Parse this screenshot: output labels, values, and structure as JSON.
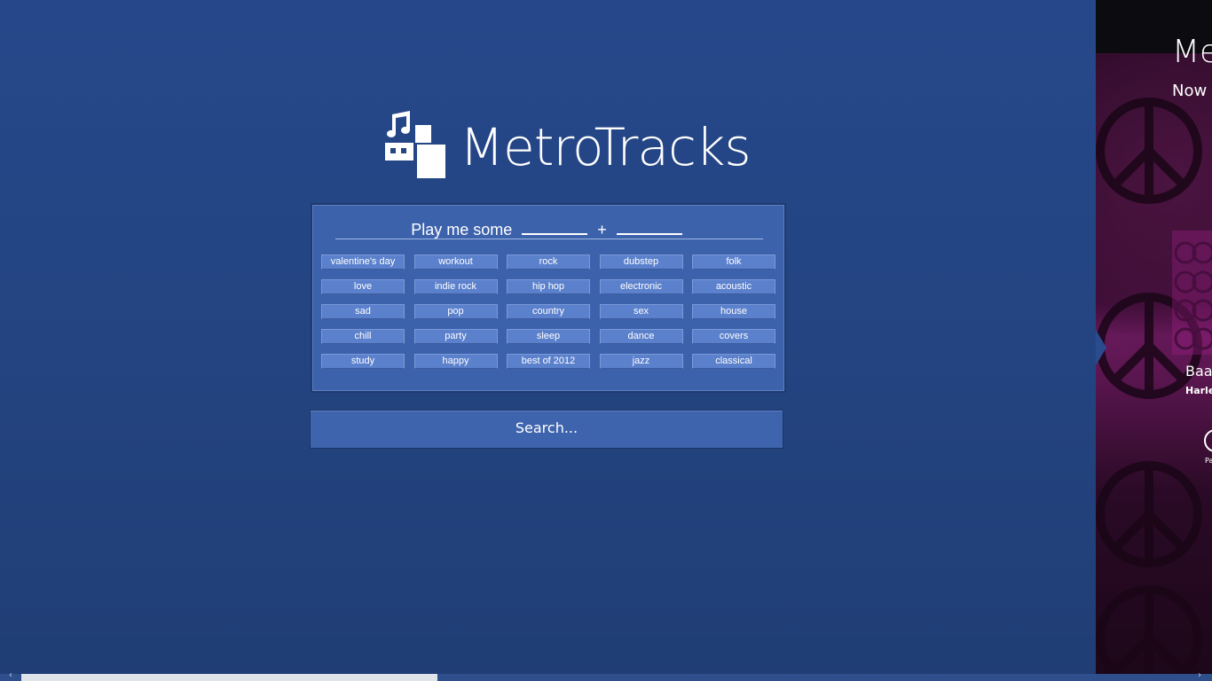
{
  "app": {
    "title": "MetroTracks"
  },
  "prompt": {
    "label": "Play me some",
    "plus": "+"
  },
  "tags": [
    "valentine's day",
    "workout",
    "rock",
    "dubstep",
    "folk",
    "love",
    "indie rock",
    "hip hop",
    "electronic",
    "acoustic",
    "sad",
    "pop",
    "country",
    "sex",
    "house",
    "chill",
    "party",
    "sleep",
    "dance",
    "covers",
    "study",
    "happy",
    "best of 2012",
    "jazz",
    "classical"
  ],
  "search": {
    "label": "Search..."
  },
  "side_panel": {
    "title": "Me",
    "subtitle": "Now",
    "track": "Baa",
    "artist": "Harle",
    "play_label": "Pa"
  },
  "colors": {
    "background": "#25457f",
    "panel": "#3d62ac",
    "tag": "#5b80cc",
    "side_accent": "#6b1a5e"
  },
  "scrollbar": {
    "left_arrow": "‹",
    "right_arrow": "›"
  }
}
